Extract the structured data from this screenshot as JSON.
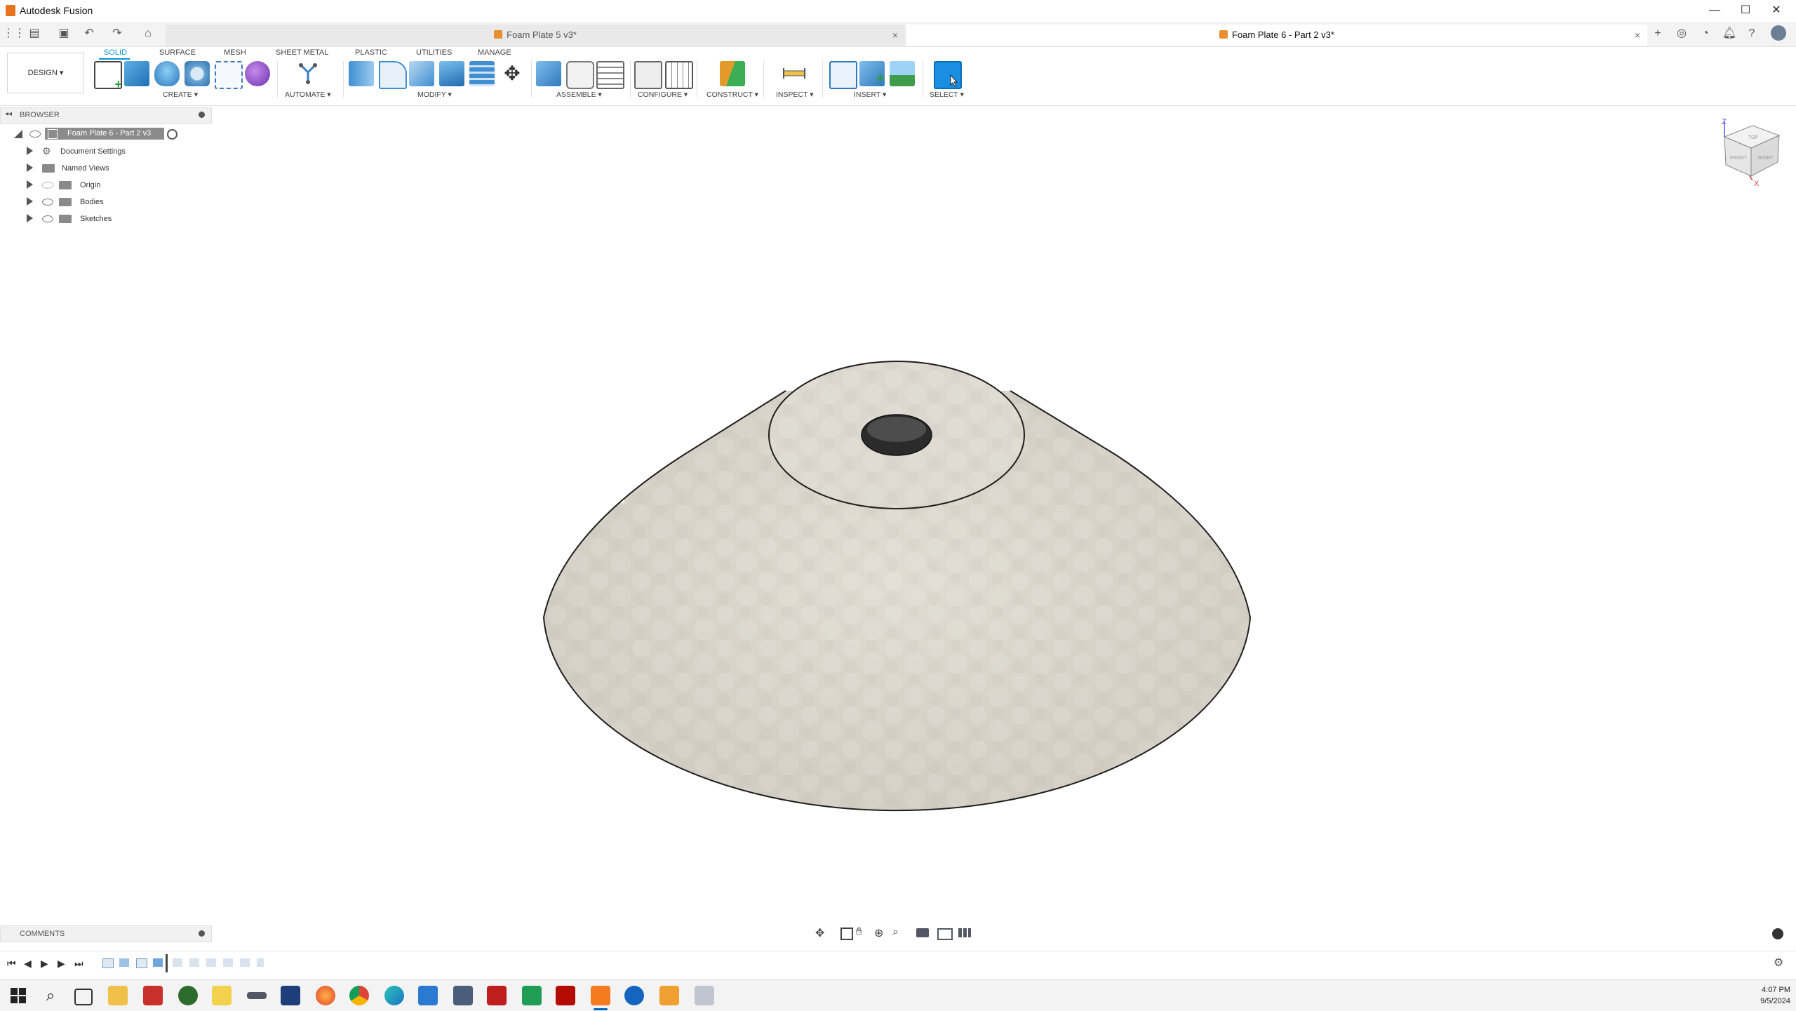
{
  "app": {
    "title": "Autodesk Fusion"
  },
  "window_controls": {
    "minimize": "—",
    "maximize": "☐",
    "close": "✕"
  },
  "tabs": [
    {
      "label": "Foam Plate 5 v3*",
      "active": false,
      "close": "×"
    },
    {
      "label": "Foam Plate 6 - Part 2 v3*",
      "active": true,
      "close": "×"
    }
  ],
  "workspace": {
    "label": "DESIGN",
    "arrow": "▾"
  },
  "workspace_tabs": [
    "SOLID",
    "SURFACE",
    "MESH",
    "SHEET METAL",
    "PLASTIC",
    "UTILITIES",
    "MANAGE"
  ],
  "tool_groups": [
    "CREATE ▾",
    "AUTOMATE ▾",
    "MODIFY ▾",
    "ASSEMBLE ▾",
    "CONFIGURE ▾",
    "CONSTRUCT ▾",
    "INSPECT ▾",
    "INSERT ▾",
    "SELECT ▾"
  ],
  "browser": {
    "title": "BROWSER",
    "collapse": "◂◂",
    "root": "Foam Plate 6 - Part 2 v3",
    "items": [
      "Document Settings",
      "Named Views",
      "Origin",
      "Bodies",
      "Sketches"
    ]
  },
  "viewcube": {
    "top": "TOP",
    "front": "FRONT",
    "right": "RIGHT",
    "x": "X",
    "z": "Z"
  },
  "comments": {
    "title": "COMMENTS"
  },
  "taskbar": {
    "time": "4:07 PM",
    "date": "9/5/2024"
  },
  "colors": {
    "accent": "#0696d7",
    "model_surface": "#d9d5cb",
    "model_outline": "#1e1e1e"
  },
  "icons": [
    "grid-icon",
    "file-icon",
    "save-icon",
    "undo-icon",
    "redo-icon",
    "home-icon",
    "settings-icon"
  ]
}
